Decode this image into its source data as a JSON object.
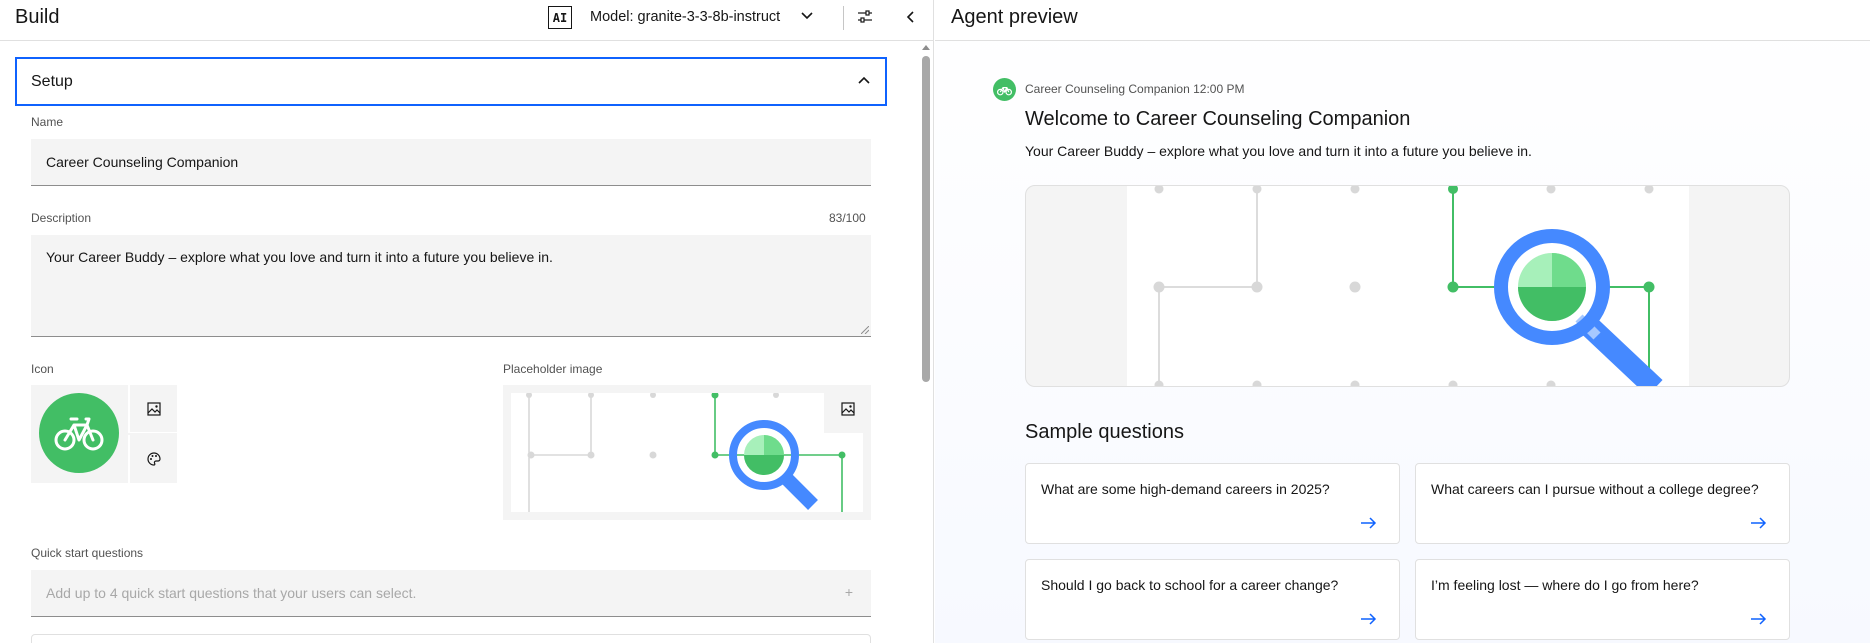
{
  "build": {
    "title": "Build",
    "ai_badge": "AI",
    "model_label": "Model: granite-3-3-8b-instruct",
    "setup_label": "Setup",
    "name_label": "Name",
    "name_value": "Career Counseling Companion",
    "description_label": "Description",
    "description_counter": "83/100",
    "description_value": "Your Career Buddy – explore what you love and turn it into a future you believe in.",
    "icon_label": "Icon",
    "placeholder_image_label": "Placeholder image",
    "quick_start_label": "Quick start questions",
    "quick_start_placeholder": "Add up to 4 quick start questions that your users can select.",
    "quick_start_plus": "+"
  },
  "preview": {
    "title": "Agent preview",
    "message_meta": "Career Counseling Companion 12:00 PM",
    "welcome_title": "Welcome to Career Counseling Companion",
    "welcome_subtitle": "Your Career Buddy – explore what you love and turn it into a future you believe in.",
    "sample_questions_title": "Sample questions",
    "sample_questions": [
      "What are some high-demand careers in 2025?",
      "What careers can I pursue without a college degree?",
      "Should I go back to school for a career change?",
      "I’m feeling lost — where do I go from here?"
    ]
  },
  "icons": {
    "agent_icon": "bicycle-icon",
    "image_upload": "image-icon",
    "color_palette": "palette-icon",
    "settings": "sliders-icon",
    "collapse": "chevron-left-icon",
    "card_action": "arrow-right-icon"
  },
  "colors": {
    "accent_blue": "#0f62fe",
    "brand_green": "#42be65",
    "magnifier_blue": "#4589ff",
    "field_bg": "#f4f4f4"
  }
}
